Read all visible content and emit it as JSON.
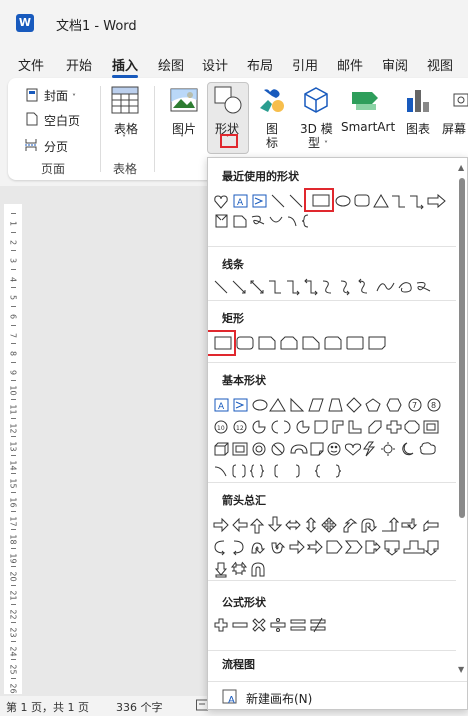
{
  "titlebar": {
    "logo": "W",
    "title": "文档1  -  Word"
  },
  "menu": {
    "tabs": [
      {
        "label": "文件"
      },
      {
        "label": "开始"
      },
      {
        "label": "插入"
      },
      {
        "label": "绘图"
      },
      {
        "label": "设计"
      },
      {
        "label": "布局"
      },
      {
        "label": "引用"
      },
      {
        "label": "邮件"
      },
      {
        "label": "审阅"
      },
      {
        "label": "视图"
      }
    ],
    "active": "插入"
  },
  "ribbon": {
    "cover": "封面",
    "blank_page": "空白页",
    "page_break": "分页",
    "group_pages": "页面",
    "table": "表格",
    "group_table": "表格",
    "picture": "图片",
    "shapes_line1": "形状",
    "icons_line1": "图",
    "icons_line2": "标",
    "model_line1": "3D 模",
    "model_line2": "型",
    "smartart": "SmartArt",
    "chart": "图表",
    "screenshot": "屏幕"
  },
  "dropdown": {
    "recent_title": "最近使用的形状",
    "lines_title": "线条",
    "rect_title": "矩形",
    "basic_title": "基本形状",
    "arrows_title": "箭头总汇",
    "equation_title": "公式形状",
    "flowchart_title": "流程图",
    "new_canvas": "新建画布(N)"
  },
  "status": {
    "page": "第 1 页，共 1 页",
    "words": "336 个字"
  },
  "ruler_numbers": [
    "1",
    "2",
    "3",
    "4",
    "5",
    "6",
    "7",
    "8",
    "9",
    "10",
    "11",
    "12",
    "13",
    "14",
    "15",
    "16",
    "17",
    "18",
    "19",
    "20",
    "21",
    "22",
    "23",
    "24",
    "25",
    "26"
  ],
  "colors": {
    "accent": "#185abd",
    "highlight": "#e0282e"
  }
}
